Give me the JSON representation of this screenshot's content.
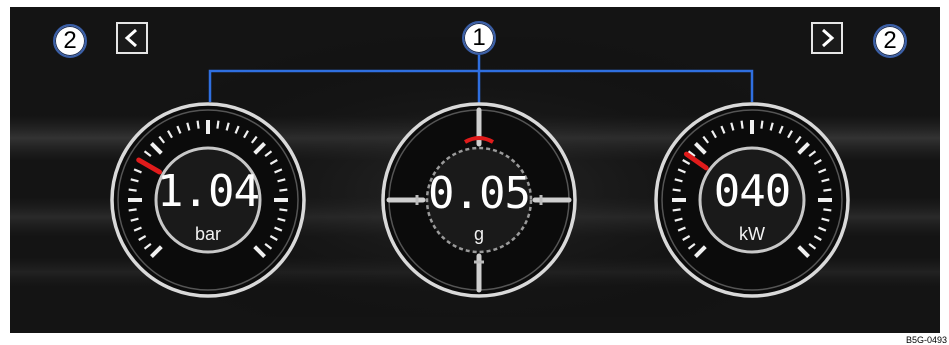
{
  "callouts": {
    "center_number": "1",
    "left_number": "2",
    "right_number": "2"
  },
  "nav": {
    "prev_icon": "chevron-left-icon",
    "next_icon": "chevron-right-icon"
  },
  "gauges": [
    {
      "id": "pressure",
      "value": "1.04",
      "unit": "bar",
      "type": "dial"
    },
    {
      "id": "gforce",
      "value": "0.05",
      "unit": "g",
      "type": "crosshair"
    },
    {
      "id": "power",
      "value": "040",
      "unit": "kW",
      "type": "dial"
    }
  ],
  "figure_code": "B5G-0493",
  "colors": {
    "callout_ring": "#3a5fa8",
    "leader_line": "#2f6fe0",
    "needle": "#e01b1b",
    "screen_bg": "#151515"
  }
}
